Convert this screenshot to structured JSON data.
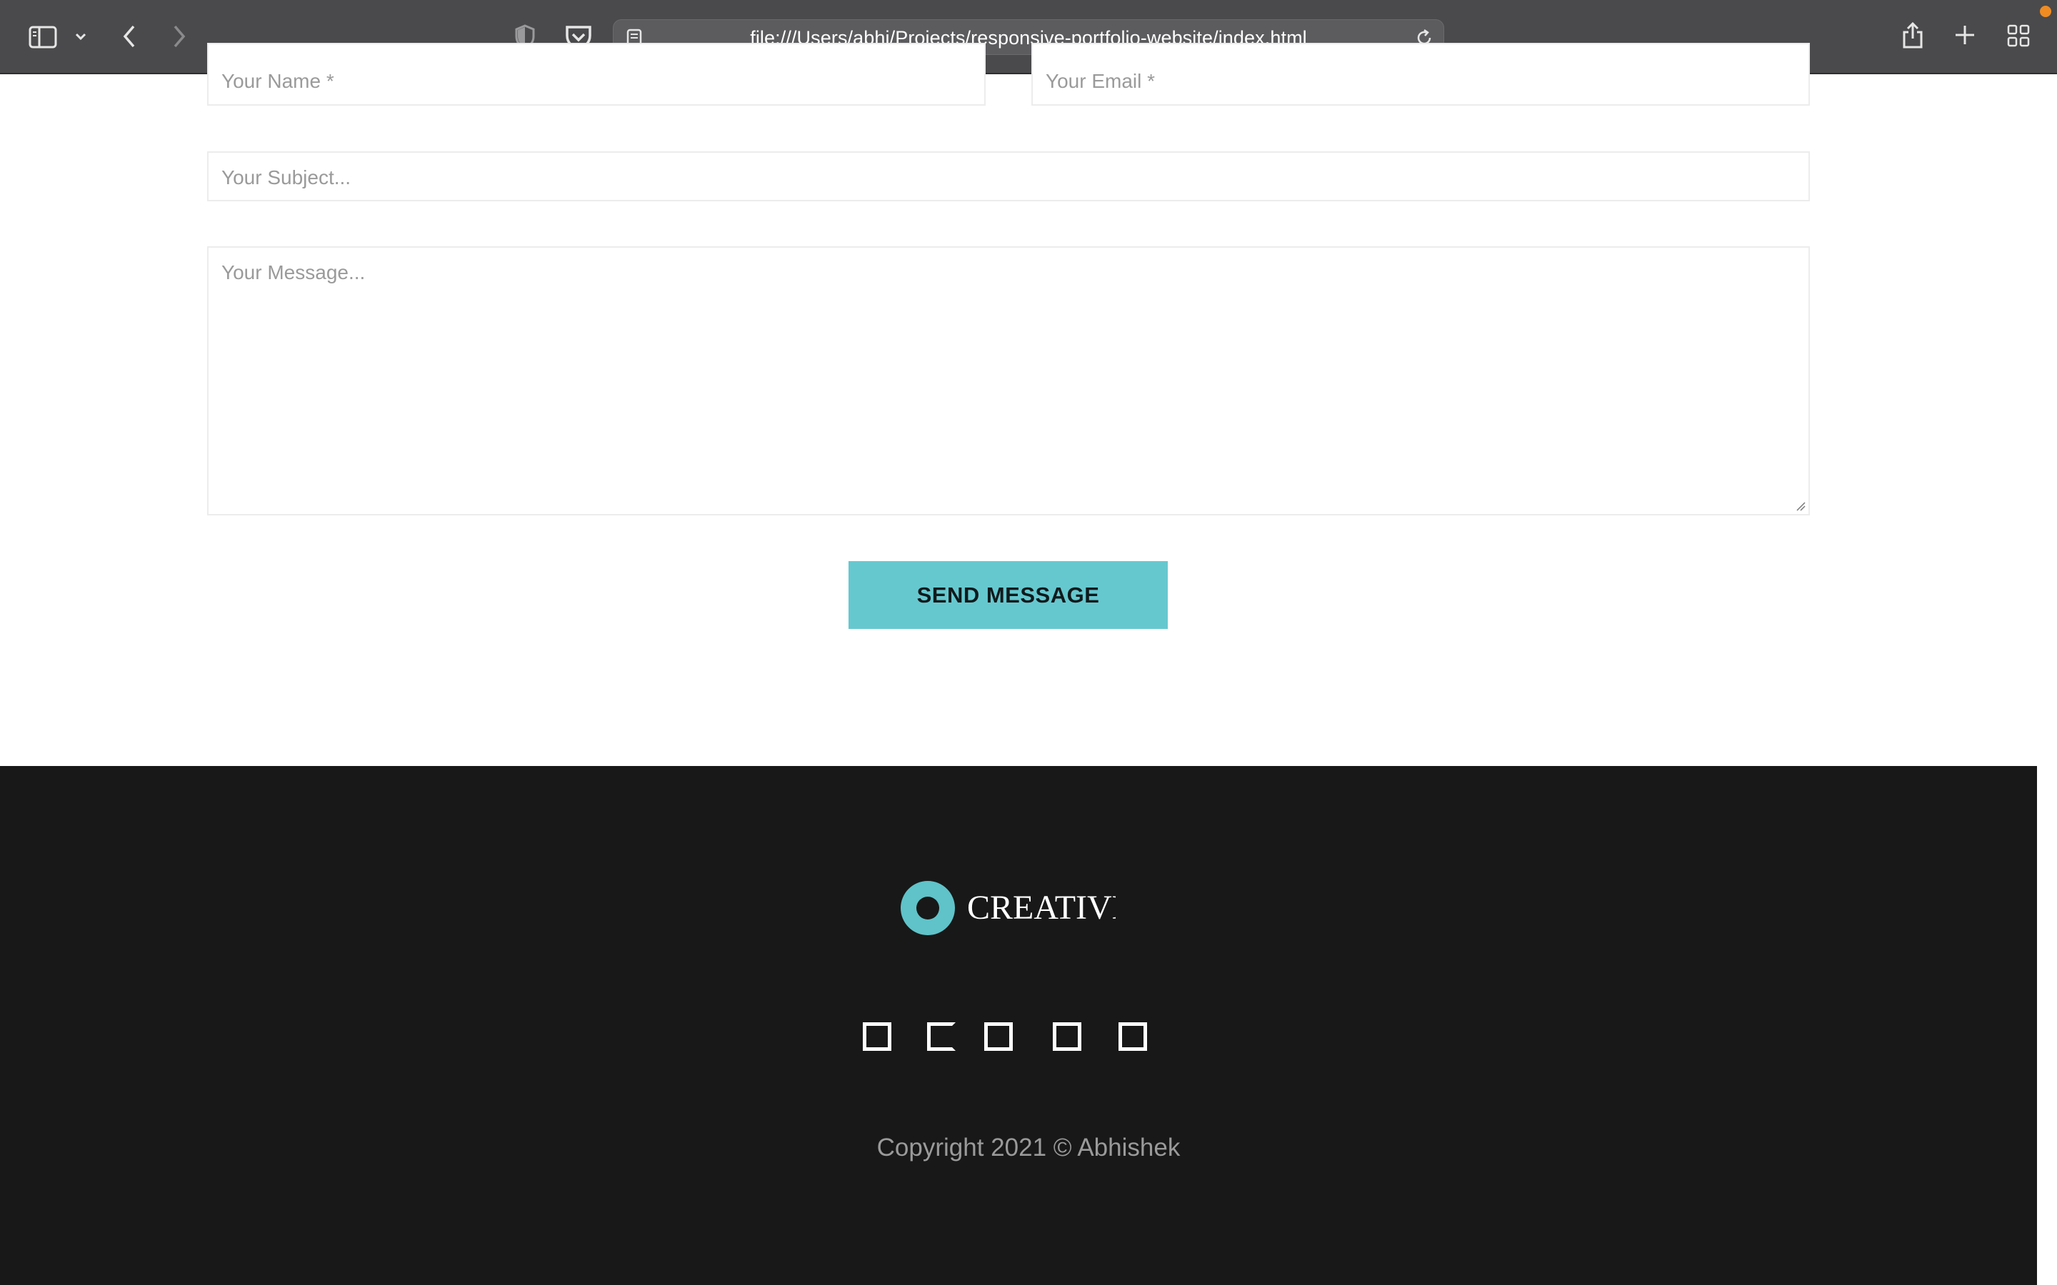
{
  "browser": {
    "url": "file:///Users/abhi/Projects/responsive-portfolio-website/index.html",
    "icons": [
      "sidebar-icon",
      "chevron-down-icon",
      "back-icon",
      "forward-icon",
      "shield-icon",
      "pocket-icon",
      "reader-icon",
      "reload-icon",
      "share-icon",
      "plus-icon",
      "tabs-overview-icon"
    ]
  },
  "form": {
    "name_placeholder": "Your Name *",
    "email_placeholder": "Your Email *",
    "subject_placeholder": "Your Subject...",
    "message_placeholder": "Your Message...",
    "send_label": "SEND MESSAGE"
  },
  "footer": {
    "logo_text": "CREATIVE",
    "social_icons": [
      "social-icon-1",
      "social-icon-2",
      "social-icon-3",
      "social-icon-4",
      "social-icon-5"
    ],
    "copyright": "Copyright 2021 © Abhishek"
  },
  "colors": {
    "accent": "#66c8cf",
    "footer_bg": "#181818",
    "toolbar_bg": "#4a4a4c"
  }
}
